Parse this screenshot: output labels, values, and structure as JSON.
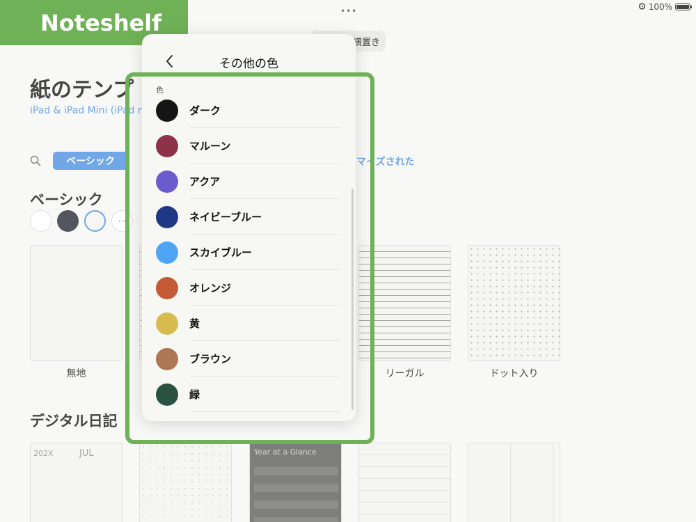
{
  "status_bar": {
    "dots": "•••",
    "battery": "100%"
  },
  "brand": "Noteshelf",
  "background": {
    "orientation_button": "横置き",
    "title": "紙のテンプ",
    "subtitle": "iPad & iPad Mini (iPad m",
    "tabs": {
      "basic": "ベーシック",
      "customized": "マイズされた"
    },
    "section_basic": "ベーシック",
    "more_label": "···",
    "templates": {
      "plain": "無地",
      "legal": "リーガル",
      "dot": "ドット入り"
    },
    "section_diary": "デジタル日記",
    "diary": {
      "year": "202X",
      "month": "JUL",
      "year_at_glance": "Year at a Glance"
    }
  },
  "popover": {
    "title": "その他の色",
    "section_label": "色",
    "colors": [
      {
        "name": "ダーク",
        "hex": "#151515"
      },
      {
        "name": "マルーン",
        "hex": "#8e3249"
      },
      {
        "name": "アクア",
        "hex": "#6b5bcd"
      },
      {
        "name": "ネイビーブルー",
        "hex": "#1e3886"
      },
      {
        "name": "スカイブルー",
        "hex": "#4ea5f3"
      },
      {
        "name": "オレンジ",
        "hex": "#c55a36"
      },
      {
        "name": "黄",
        "hex": "#d8bb4f"
      },
      {
        "name": "ブラウン",
        "hex": "#ae7754"
      },
      {
        "name": "緑",
        "hex": "#2a5243"
      }
    ]
  },
  "colors": {
    "brand_green": "#6fb157",
    "accent_blue": "#4a8fe0"
  },
  "icons": {
    "back": "chevron-left-icon",
    "search": "search-icon",
    "battery": "battery-icon",
    "alarm": "alarm-icon"
  }
}
